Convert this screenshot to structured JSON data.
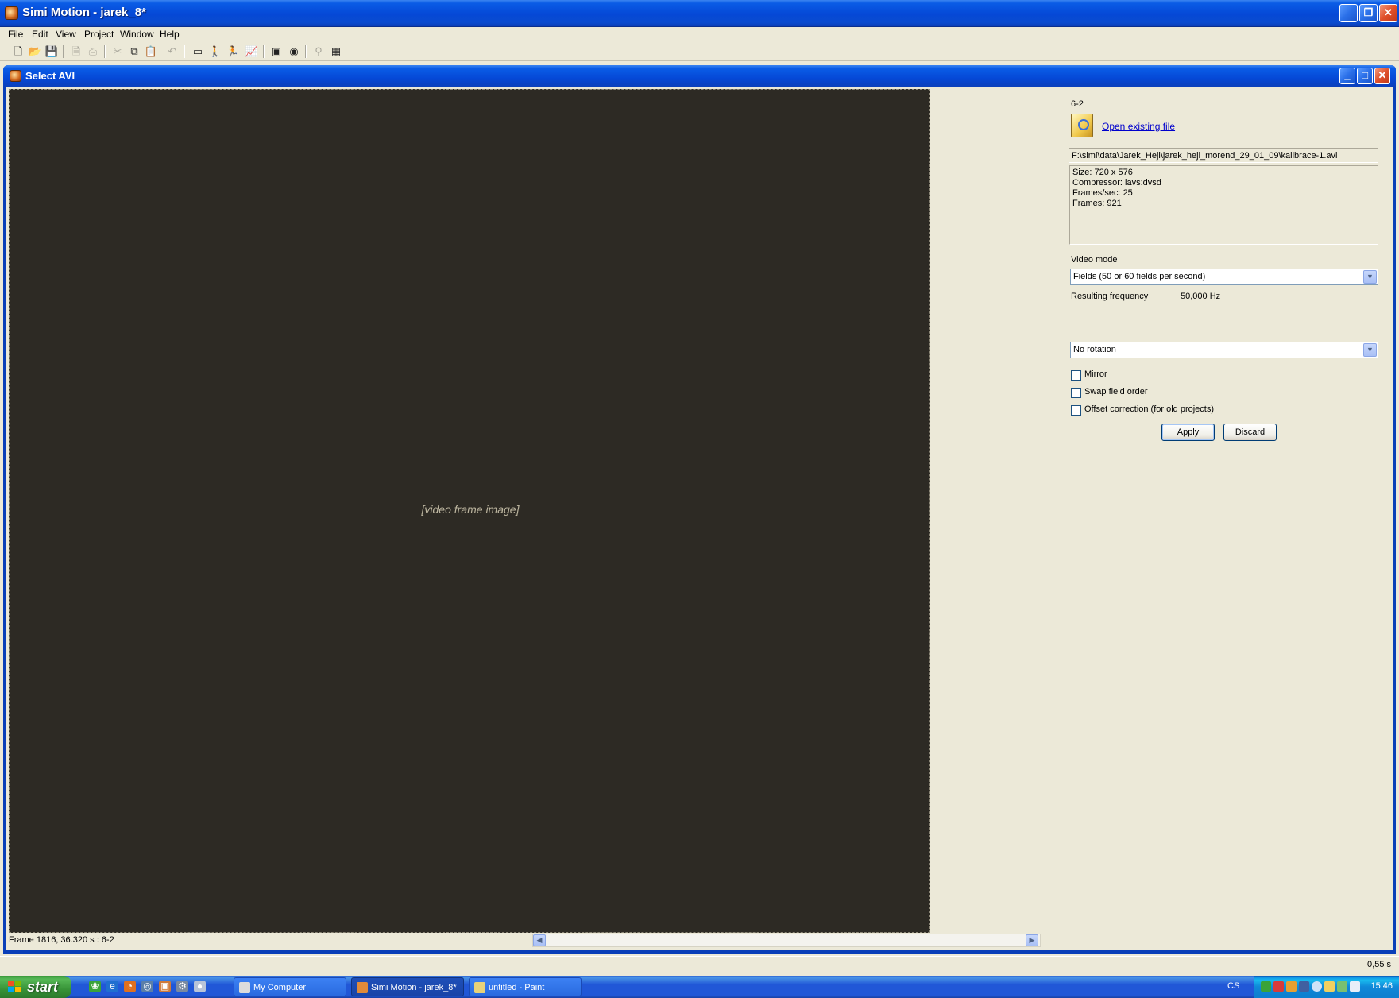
{
  "app": {
    "title": "Simi Motion - jarek_8*",
    "menu": [
      "File",
      "Edit",
      "View",
      "Project",
      "Window",
      "Help"
    ]
  },
  "toolbar": {
    "buttons": [
      {
        "name": "new-icon",
        "glyph": "🗋"
      },
      {
        "name": "open-icon",
        "glyph": "📂"
      },
      {
        "name": "save-icon",
        "glyph": "💾"
      },
      {
        "name": "print-preview-icon",
        "glyph": "🗎"
      },
      {
        "name": "print-icon",
        "glyph": "⎙"
      },
      {
        "name": "cut-icon",
        "glyph": "✂"
      },
      {
        "name": "copy-icon",
        "glyph": "⧉"
      },
      {
        "name": "paste-icon",
        "glyph": "📋"
      },
      {
        "name": "undo-icon",
        "glyph": "↶"
      },
      {
        "name": "window-icon",
        "glyph": "▭"
      },
      {
        "name": "person-icon",
        "glyph": "🚶"
      },
      {
        "name": "run-icon",
        "glyph": "🏃"
      },
      {
        "name": "chart-icon",
        "glyph": "📈"
      },
      {
        "name": "video-icon",
        "glyph": "▣"
      },
      {
        "name": "camera-icon",
        "glyph": "◉"
      },
      {
        "name": "stick-figure-icon",
        "glyph": "⚲"
      },
      {
        "name": "calendar-icon",
        "glyph": "▦"
      }
    ]
  },
  "child_window": {
    "title": "Select AVI"
  },
  "video": {
    "frame_status": "Frame 1816, 36.320 s : 6-2"
  },
  "panel": {
    "stream_label": "6-2",
    "open_link": "Open existing file",
    "file_path": "F:\\simi\\data\\Jarek_Hejl\\jarek_hejl_morend_29_01_09\\kalibrace-1.avi",
    "file_info": [
      "Size: 720 x 576",
      "Compressor: iavs:dvsd",
      "Frames/sec: 25",
      "Frames: 921"
    ],
    "video_mode_label": "Video mode",
    "video_mode_value": "Fields (50 or 60 fields per second)",
    "freq_label": "Resulting frequency",
    "freq_value": "50,000 Hz",
    "rotation_value": "No rotation",
    "mirror_label": "Mirror",
    "mirror_checked": false,
    "swap_label": "Swap field order",
    "swap_checked": false,
    "offset_label": "Offset correction (for old projects)",
    "offset_checked": false,
    "apply_label": "Apply",
    "discard_label": "Discard"
  },
  "statusbar": {
    "time": "0,55 s"
  },
  "taskbar": {
    "start_label": "start",
    "tasks": [
      {
        "label": "My Computer",
        "active": false,
        "icon_color": "#dcdcdc"
      },
      {
        "label": "Simi Motion - jarek_8*",
        "active": true,
        "icon_color": "#e08a3a"
      },
      {
        "label": "untitled - Paint",
        "active": false,
        "icon_color": "#e8d27a"
      }
    ],
    "language": "CS",
    "clock": "15:46"
  }
}
